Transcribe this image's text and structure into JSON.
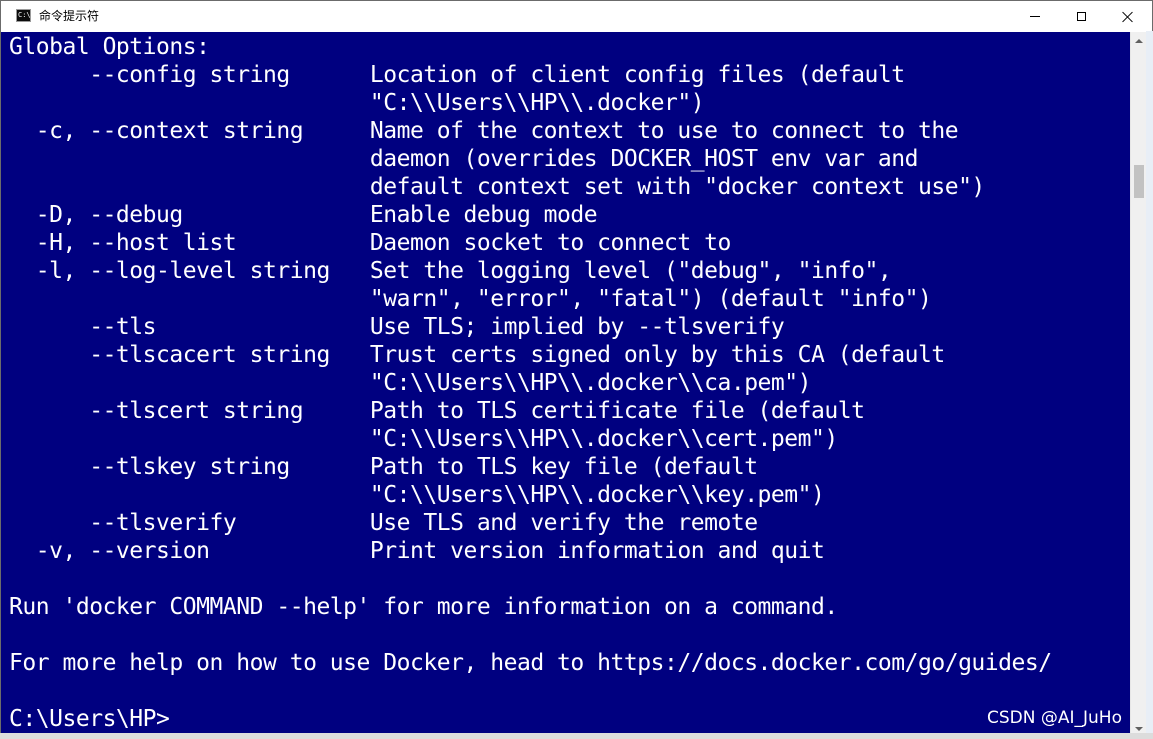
{
  "window": {
    "title": "命令提示符",
    "icon": "cmd-icon",
    "controls": {
      "minimize": "minimize-icon",
      "maximize": "maximize-icon",
      "close": "close-icon"
    },
    "background_color": "#000080",
    "text_color": "#ffffff"
  },
  "console": {
    "lines": [
      "Global Options:",
      "      --config string      Location of client config files (default",
      "                           \"C:\\\\Users\\\\HP\\\\.docker\")",
      "  -c, --context string     Name of the context to use to connect to the",
      "                           daemon (overrides DOCKER_HOST env var and",
      "                           default context set with \"docker context use\")",
      "  -D, --debug              Enable debug mode",
      "  -H, --host list          Daemon socket to connect to",
      "  -l, --log-level string   Set the logging level (\"debug\", \"info\",",
      "                           \"warn\", \"error\", \"fatal\") (default \"info\")",
      "      --tls                Use TLS; implied by --tlsverify",
      "      --tlscacert string   Trust certs signed only by this CA (default",
      "                           \"C:\\\\Users\\\\HP\\\\.docker\\\\ca.pem\")",
      "      --tlscert string     Path to TLS certificate file (default",
      "                           \"C:\\\\Users\\\\HP\\\\.docker\\\\cert.pem\")",
      "      --tlskey string      Path to TLS key file (default",
      "                           \"C:\\\\Users\\\\HP\\\\.docker\\\\key.pem\")",
      "      --tlsverify          Use TLS and verify the remote",
      "  -v, --version            Print version information and quit",
      "",
      "Run 'docker COMMAND --help' for more information on a command.",
      "",
      "For more help on how to use Docker, head to https://docs.docker.com/go/guides/",
      "",
      "C:\\Users\\HP>"
    ]
  },
  "watermark": "CSDN @AI_JuHo"
}
